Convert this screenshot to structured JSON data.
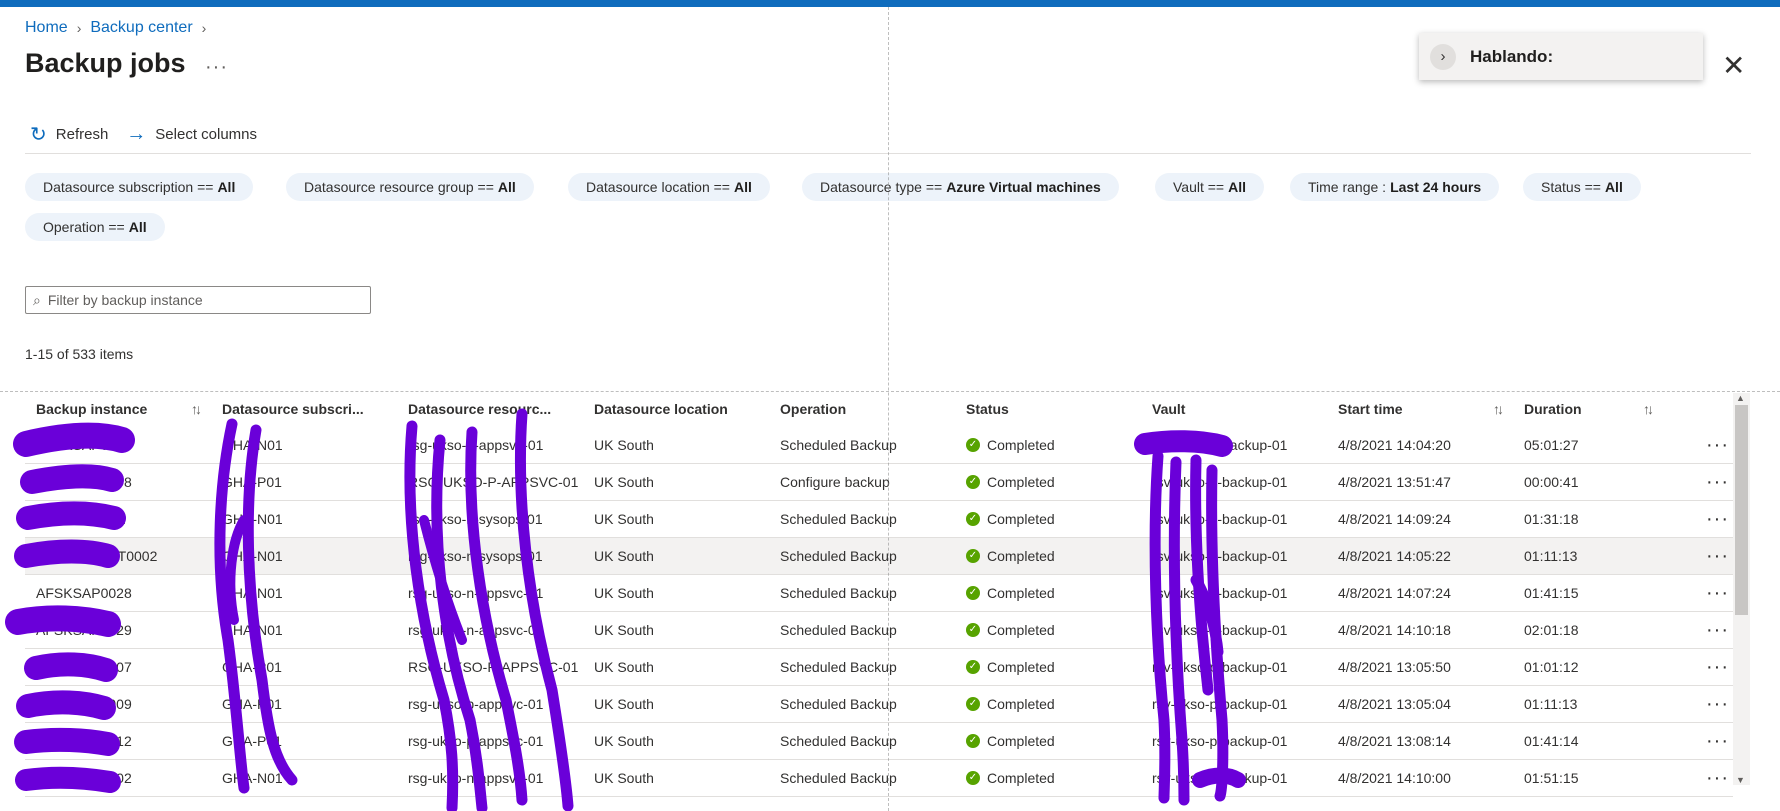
{
  "breadcrumb": {
    "home": "Home",
    "backup_center": "Backup center"
  },
  "page": {
    "title": "Backup jobs",
    "more": "···"
  },
  "speaking_panel": {
    "label": "Hablando:"
  },
  "toolbar": {
    "refresh": "Refresh",
    "select_columns": "Select columns"
  },
  "filters": [
    {
      "key": "Datasource subscription ==",
      "value": "All"
    },
    {
      "key": "Datasource resource group ==",
      "value": "All"
    },
    {
      "key": "Datasource location ==",
      "value": "All"
    },
    {
      "key": "Datasource type ==",
      "value": "Azure Virtual machines"
    },
    {
      "key": "Vault ==",
      "value": "All"
    },
    {
      "key": "Time range :",
      "value": "Last 24 hours"
    },
    {
      "key": "Status ==",
      "value": "All"
    },
    {
      "key": "Operation ==",
      "value": "All"
    }
  ],
  "search": {
    "placeholder": "Filter by backup instance"
  },
  "list": {
    "count": "1-15 of 533 items"
  },
  "table": {
    "columns": [
      "Backup instance",
      "Datasource subscri...",
      "Datasource resourc...",
      "Datasource location",
      "Operation",
      "Status",
      "Vault",
      "Start time",
      "Duration"
    ],
    "rows": [
      [
        "AFSKSAP0014",
        "GHA-N01",
        "rsg-ukso-n-appsvc-01",
        "UK South",
        "Scheduled Backup",
        "Completed",
        "rsv-ukso-n-backup-01",
        "4/8/2021 14:04:20",
        "05:01:27"
      ],
      [
        "AFSKSAP0008",
        "GHA-P01",
        "RSG-UKSO-P-APPSVC-01",
        "UK South",
        "Configure backup",
        "Completed",
        "rsv-ukso-p-backup-01",
        "4/8/2021 13:51:47",
        "00:00:41"
      ],
      [
        "afsksaaw0001",
        "GHA-N01",
        "rsg-ukso-n-sysops-01",
        "UK South",
        "Scheduled Backup",
        "Completed",
        "rsv-ukso-n-backup-01",
        "4/8/2021 14:09:24",
        "01:31:18"
      ],
      [
        "AFSKAZTEST0002",
        "GHA-N01",
        "rsg-ukso-n-sysops-01",
        "UK South",
        "Scheduled Backup",
        "Completed",
        "rsv-ukso-n-backup-01",
        "4/8/2021 14:05:22",
        "01:11:13"
      ],
      [
        "AFSKSAP0028",
        "GHA-N01",
        "rsg-ukso-n-appsvc-01",
        "UK South",
        "Scheduled Backup",
        "Completed",
        "rsv-ukso-n-backup-01",
        "4/8/2021 14:07:24",
        "01:41:15"
      ],
      [
        "AFSKSAP0029",
        "GHA-N01",
        "rsg-ukso-n-appsvc-01",
        "UK South",
        "Scheduled Backup",
        "Completed",
        "rsv-ukso-n-backup-01",
        "4/8/2021 14:10:18",
        "02:01:18"
      ],
      [
        "AFSKSAP0007",
        "GHA-P01",
        "RSG-UKSO-P-APPSVC-01",
        "UK South",
        "Scheduled Backup",
        "Completed",
        "rsv-ukso-p-backup-01",
        "4/8/2021 13:05:50",
        "01:01:12"
      ],
      [
        "AFSKSAP0009",
        "GHA-P01",
        "rsg-ukso-p-appsvc-01",
        "UK South",
        "Scheduled Backup",
        "Completed",
        "rsv-ukso-p-backup-01",
        "4/8/2021 13:05:04",
        "01:11:13"
      ],
      [
        "AFSKSAP0012",
        "GHA-P01",
        "rsg-ukso-p-appsvc-01",
        "UK South",
        "Scheduled Backup",
        "Completed",
        "rsv-ukso-p-backup-01",
        "4/8/2021 13:08:14",
        "01:41:14"
      ],
      [
        "AFSKSAP0002",
        "GHA-N01",
        "rsg-ukso-n-appsvc-01",
        "UK South",
        "Scheduled Backup",
        "Completed",
        "rsv-ukso-n-backup-01",
        "4/8/2021 14:10:00",
        "01:51:15"
      ]
    ],
    "row_more": "···",
    "highlighted_row": 3
  },
  "colors": {
    "accent": "#0f6cbd",
    "success": "#57a300",
    "redaction": "#6a00d9",
    "pill": "#edf3fa"
  },
  "icons": [
    "chevron-right-icon",
    "refresh-icon",
    "arrow-right-icon",
    "search-icon",
    "close-icon",
    "check-circle-icon",
    "sort-icon",
    "more-icon"
  ]
}
